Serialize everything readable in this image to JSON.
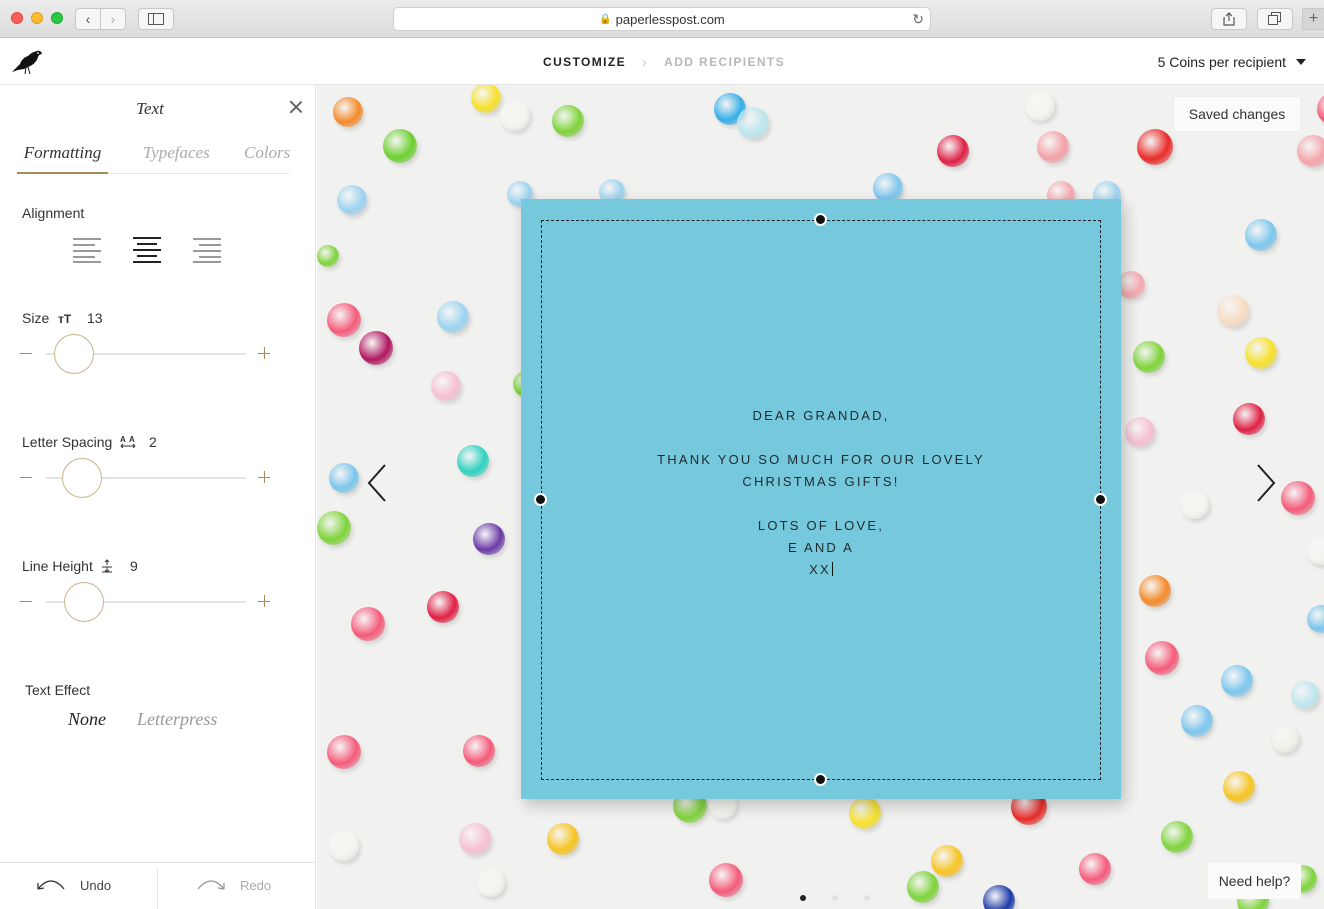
{
  "browser": {
    "url": "paperlesspost.com"
  },
  "header": {
    "steps": [
      "CUSTOMIZE",
      "ADD RECIPIENTS"
    ],
    "coins_label": "5 Coins per recipient"
  },
  "panel": {
    "title": "Text",
    "tabs": [
      "Formatting",
      "Typefaces",
      "Colors"
    ],
    "active_tab": "Formatting",
    "alignment": {
      "label": "Alignment",
      "selected": "center"
    },
    "size": {
      "label": "Size",
      "value": "13"
    },
    "letter_spacing": {
      "label": "Letter Spacing",
      "value": "2"
    },
    "line_height": {
      "label": "Line Height",
      "value": "9"
    },
    "text_effect": {
      "label": "Text Effect",
      "options": [
        "None",
        "Letterpress"
      ],
      "selected": "None"
    },
    "undo_label": "Undo",
    "redo_label": "Redo"
  },
  "stage": {
    "saved_status": "Saved changes",
    "help_label": "Need help?",
    "card_color": "#76c8dc",
    "message": {
      "line1": "DEAR GRANDAD,",
      "line2": "THANK YOU SO MUCH FOR OUR LOVELY",
      "line3": "CHRISTMAS GIFTS!",
      "line4": "LOTS OF LOVE,",
      "line5": "E AND A",
      "line6": "XX"
    },
    "page_count": 3,
    "current_page": 1
  },
  "colors": {
    "accent": "#a88a5a",
    "card": "#76c8dc",
    "background": "#f1f1f0"
  }
}
